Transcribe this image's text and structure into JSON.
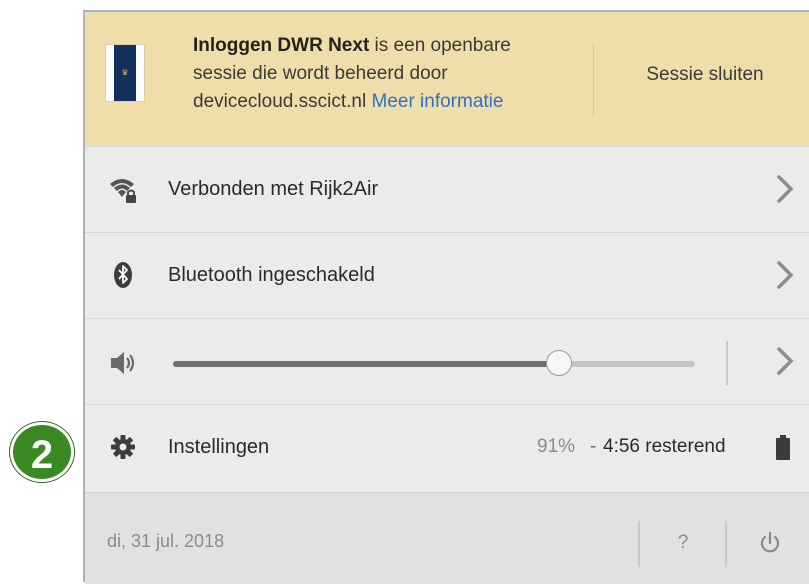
{
  "banner": {
    "title_bold": "Inloggen DWR Next",
    "text_line1_rest": " is een openbare",
    "text_line2": "sessie die wordt beheerd door",
    "text_line3": "devicecloud.sscict.nl",
    "more_info_link": "Meer informatie",
    "close_session_button": "Sessie sluiten",
    "logo_icon": "rijksoverheid-logo"
  },
  "network": {
    "label": "Verbonden met Rijk2Air",
    "icon": "wifi-lock-icon"
  },
  "bluetooth": {
    "label": "Bluetooth ingeschakeld",
    "icon": "bluetooth-icon"
  },
  "volume": {
    "icon": "speaker-icon",
    "level": 0.74
  },
  "settings": {
    "label": "Instellingen",
    "icon": "gear-icon",
    "battery_percent": "91%",
    "battery_separator": "-",
    "battery_remaining": "4:56 resterend",
    "battery_icon": "battery-icon"
  },
  "footer": {
    "date": "di, 31 jul. 2018",
    "help_label": "?",
    "power_icon": "power-icon"
  },
  "annotation": {
    "step_number": "2",
    "color": "#3a8a24"
  }
}
